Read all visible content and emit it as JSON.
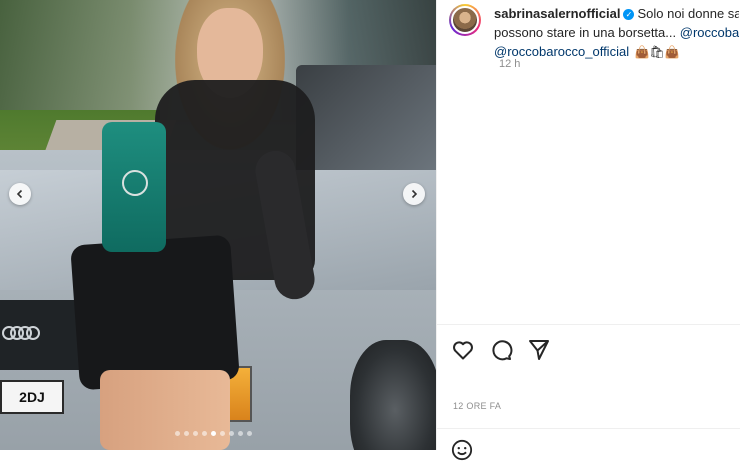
{
  "post": {
    "media": {
      "plate_text": "2DJ",
      "carousel_count": 9,
      "active_index": 4
    },
    "caption": {
      "username": "sabrinasalernofficial",
      "verified_mark": "✓",
      "line1_text": "Solo noi donne sap",
      "line2_text": "possono stare in una borsetta...",
      "mention1": "@roccoba",
      "mention2": "@roccobarocco_official",
      "emojis": "👜🛍👜",
      "time_ago": "12 h"
    },
    "date_label": "12 ORE FA",
    "icons": {
      "like": "heart-icon",
      "comment": "comment-icon",
      "share": "share-icon",
      "emoji": "emoji-icon",
      "prev": "chevron-left-icon",
      "next": "chevron-right-icon"
    }
  }
}
